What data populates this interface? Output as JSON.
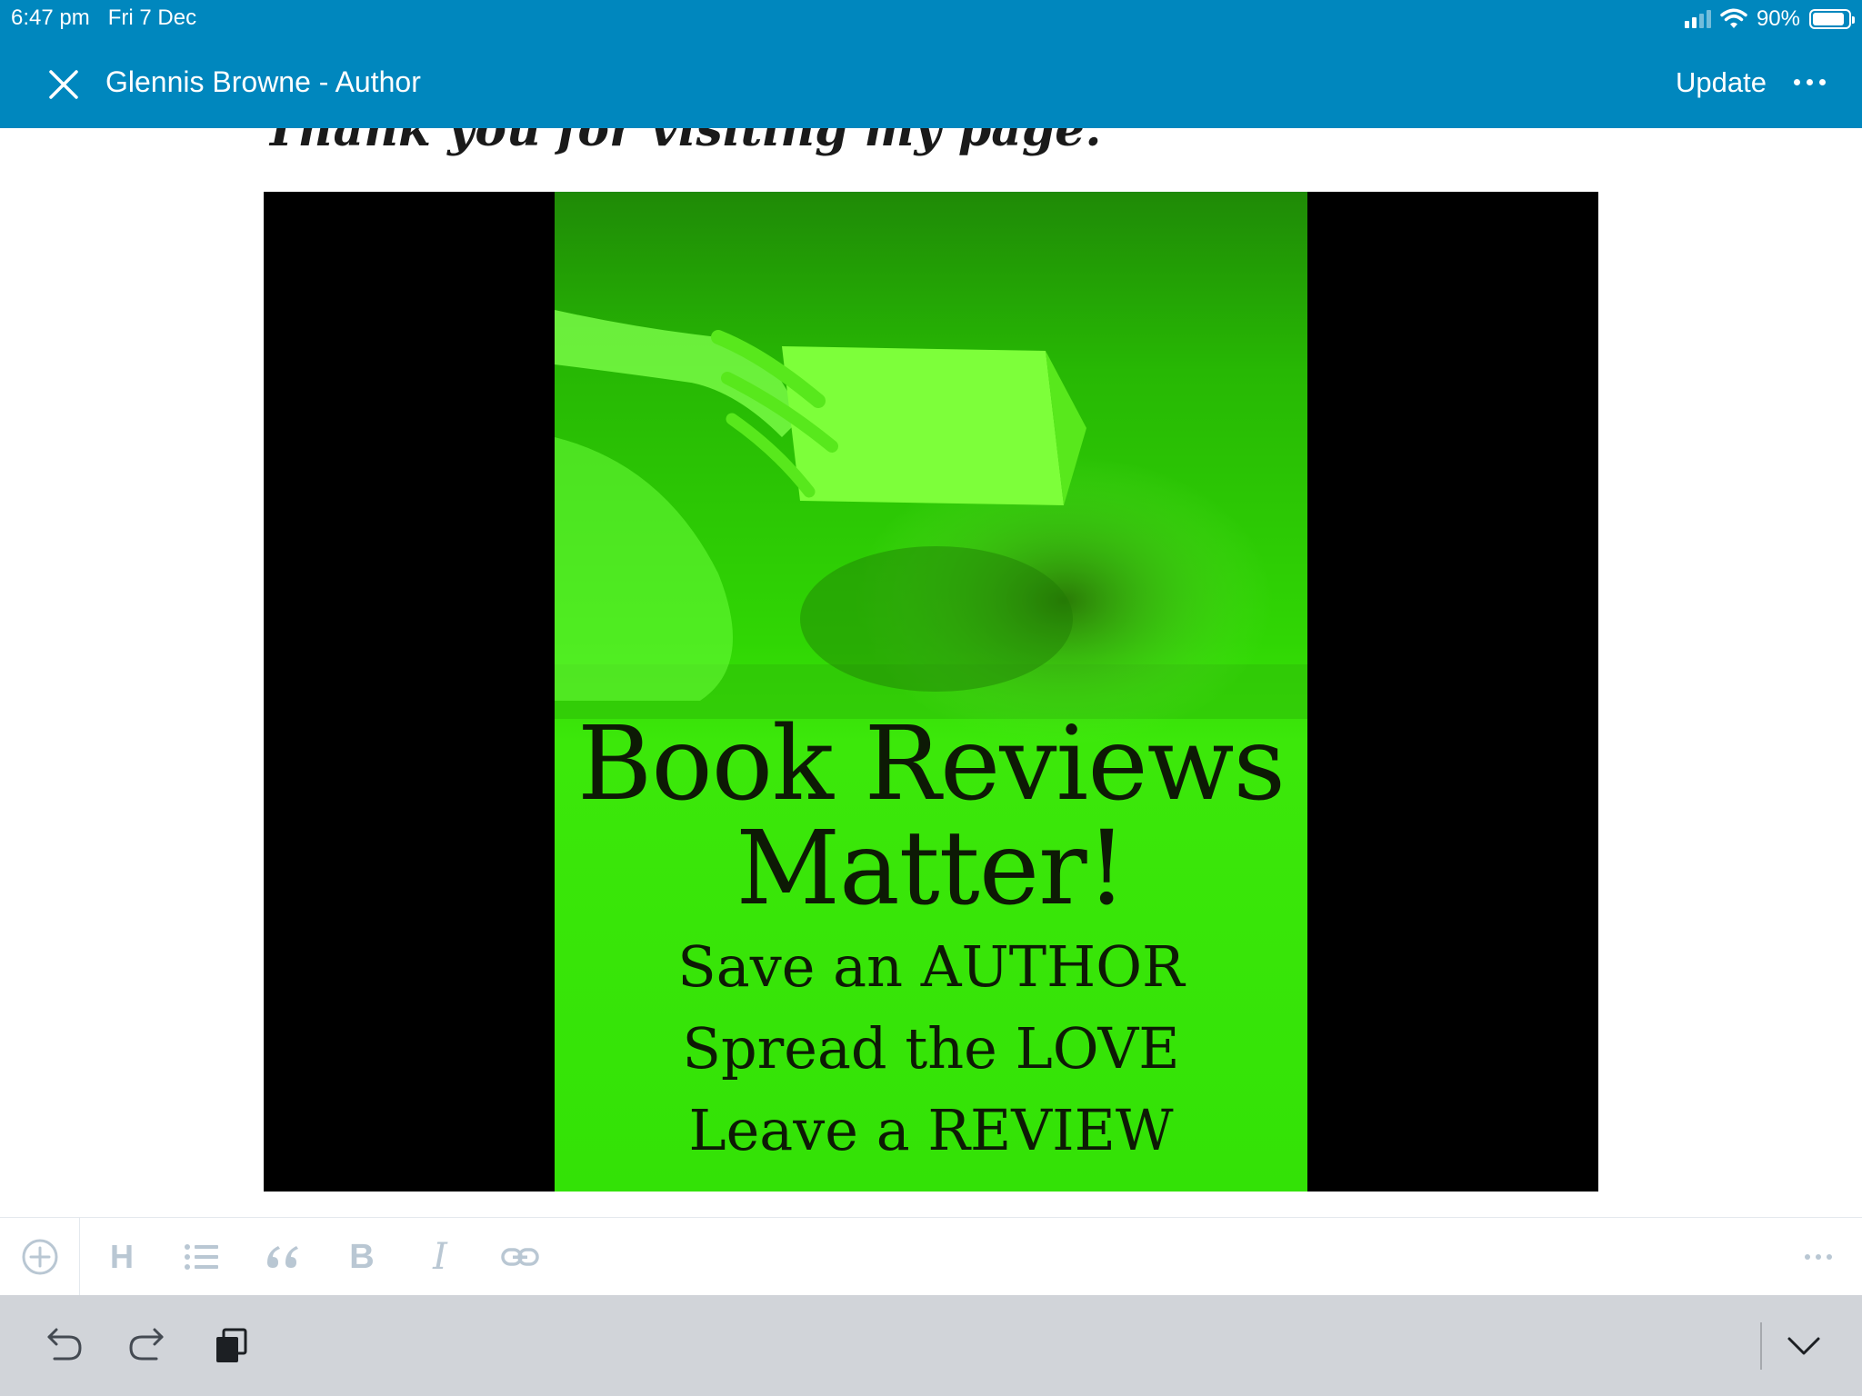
{
  "status_bar": {
    "time": "6:47 pm",
    "date": "Fri 7 Dec",
    "battery": "90%",
    "battery_level": 0.9,
    "signal_bars_active": 2,
    "signal_bars_total": 4
  },
  "nav": {
    "title": "Glennis Browne - Author",
    "update_label": "Update",
    "close_icon": "close-icon",
    "more_icon": "more-horizontal-icon"
  },
  "content": {
    "cut_off_heading": "Thank you for visiting my page.",
    "image": {
      "title_line_1": "Book Reviews",
      "title_line_2": "Matter!",
      "line_1": "Save an AUTHOR",
      "line_2": "Spread the LOVE",
      "line_3": "Leave a REVIEW"
    }
  },
  "format_toolbar": {
    "add_icon": "plus-circle-icon",
    "heading_label": "H",
    "bold_label": "B",
    "italic_label": "I",
    "icons": [
      "list-icon",
      "quote-icon",
      "link-icon",
      "more-horizontal-icon"
    ]
  },
  "keyboard_bar": {
    "icons": [
      "undo-icon",
      "redo-icon",
      "clipboard-copy-icon",
      "chevron-down-icon"
    ]
  },
  "colors": {
    "header": "#0087be",
    "poster_green": "#2ee000",
    "toolbar_icon": "#b9c7d3",
    "keyboard_bar": "#d1d4d9"
  }
}
